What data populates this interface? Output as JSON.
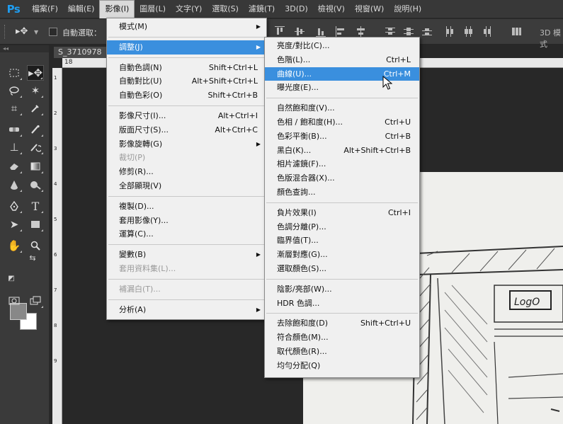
{
  "app": {
    "logo": "Ps"
  },
  "menubar": {
    "items": [
      {
        "label": "檔案(F)"
      },
      {
        "label": "編輯(E)"
      },
      {
        "label": "影像(I)"
      },
      {
        "label": "圖層(L)"
      },
      {
        "label": "文字(Y)"
      },
      {
        "label": "選取(S)"
      },
      {
        "label": "濾鏡(T)"
      },
      {
        "label": "3D(D)"
      },
      {
        "label": "檢視(V)"
      },
      {
        "label": "視窗(W)"
      },
      {
        "label": "說明(H)"
      }
    ],
    "active_index": 2
  },
  "options": {
    "auto_select_label": "自動選取：",
    "auto_select_checked": false,
    "mode_3d_label": "3D 模式"
  },
  "document": {
    "tab_title": "S_3710978",
    "ruler_start": "18"
  },
  "colors": {
    "foreground": "#888888",
    "background": "#ffffff",
    "highlight": "#3a8fde"
  },
  "image_menu": {
    "items": [
      {
        "label": "模式(M)",
        "submenu": true
      },
      {
        "separator": true
      },
      {
        "label": "調整(J)",
        "submenu": true,
        "highlight": true
      },
      {
        "separator": true
      },
      {
        "label": "自動色調(N)",
        "shortcut": "Shift+Ctrl+L"
      },
      {
        "label": "自動對比(U)",
        "shortcut": "Alt+Shift+Ctrl+L"
      },
      {
        "label": "自動色彩(O)",
        "shortcut": "Shift+Ctrl+B"
      },
      {
        "separator": true
      },
      {
        "label": "影像尺寸(I)...",
        "shortcut": "Alt+Ctrl+I"
      },
      {
        "label": "版面尺寸(S)...",
        "shortcut": "Alt+Ctrl+C"
      },
      {
        "label": "影像旋轉(G)",
        "submenu": true
      },
      {
        "label": "裁切(P)",
        "disabled": true
      },
      {
        "label": "修剪(R)..."
      },
      {
        "label": "全部顯現(V)"
      },
      {
        "separator": true
      },
      {
        "label": "複製(D)..."
      },
      {
        "label": "套用影像(Y)..."
      },
      {
        "label": "運算(C)..."
      },
      {
        "separator": true
      },
      {
        "label": "變數(B)",
        "submenu": true
      },
      {
        "label": "套用資料集(L)...",
        "disabled": true
      },
      {
        "separator": true
      },
      {
        "label": "補漏白(T)...",
        "disabled": true
      },
      {
        "separator": true
      },
      {
        "label": "分析(A)",
        "submenu": true
      }
    ]
  },
  "adjust_menu": {
    "items": [
      {
        "label": "亮度/對比(C)..."
      },
      {
        "label": "色階(L)...",
        "shortcut": "Ctrl+L"
      },
      {
        "label": "曲線(U)...",
        "shortcut": "Ctrl+M",
        "highlight": true
      },
      {
        "label": "曝光度(E)..."
      },
      {
        "separator": true
      },
      {
        "label": "自然飽和度(V)..."
      },
      {
        "label": "色相 / 飽和度(H)...",
        "shortcut": "Ctrl+U"
      },
      {
        "label": "色彩平衡(B)...",
        "shortcut": "Ctrl+B"
      },
      {
        "label": "黑白(K)...",
        "shortcut": "Alt+Shift+Ctrl+B"
      },
      {
        "label": "相片濾鏡(F)..."
      },
      {
        "label": "色版混合器(X)..."
      },
      {
        "label": "顏色查詢..."
      },
      {
        "separator": true
      },
      {
        "label": "負片效果(I)",
        "shortcut": "Ctrl+I"
      },
      {
        "label": "色調分離(P)..."
      },
      {
        "label": "臨界值(T)..."
      },
      {
        "label": "漸層對應(G)..."
      },
      {
        "label": "選取顏色(S)..."
      },
      {
        "separator": true
      },
      {
        "label": "陰影/亮部(W)..."
      },
      {
        "label": "HDR 色調..."
      },
      {
        "separator": true
      },
      {
        "label": "去除飽和度(D)",
        "shortcut": "Shift+Ctrl+U"
      },
      {
        "label": "符合顏色(M)..."
      },
      {
        "label": "取代顏色(R)..."
      },
      {
        "label": "均勻分配(Q)"
      }
    ]
  },
  "sketch": {
    "logo_text": "LogO"
  }
}
